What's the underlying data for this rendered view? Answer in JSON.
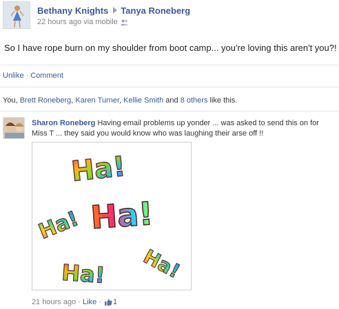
{
  "post": {
    "author": "Bethany Knights",
    "recipient": "Tanya Roneberg",
    "timestamp": "22 hours ago via mobile",
    "audience_icon": "people-icon",
    "message": "So I have rope burn on my shoulder from boot camp... you're loving this aren't you?!"
  },
  "actions": {
    "unlike": "Unlike",
    "separator": "·",
    "comment": "Comment"
  },
  "likes": {
    "prefix": "You,",
    "people": [
      "Brett Roneberg",
      "Karen Turner",
      "Kellie Smith"
    ],
    "sep1": ",",
    "sep2": ",",
    "and": "and",
    "others": "8 others",
    "suffix": "like this."
  },
  "comment": {
    "author": "Sharon Roneberg",
    "text": "Having email problems up yonder ... was asked to send this on for Miss T ... they said you would know who was laughing their arse off !!",
    "image_words": [
      "Ha!",
      "Ha!",
      "Ha!",
      "Ha!",
      "Ha!"
    ],
    "timestamp": "21 hours ago",
    "separator": "·",
    "like": "Like",
    "like_icon": "thumbs-up-icon",
    "like_count": "1"
  },
  "colors": {
    "link": "#3b5998",
    "meta": "#808080",
    "divider": "#e3e6ed"
  }
}
